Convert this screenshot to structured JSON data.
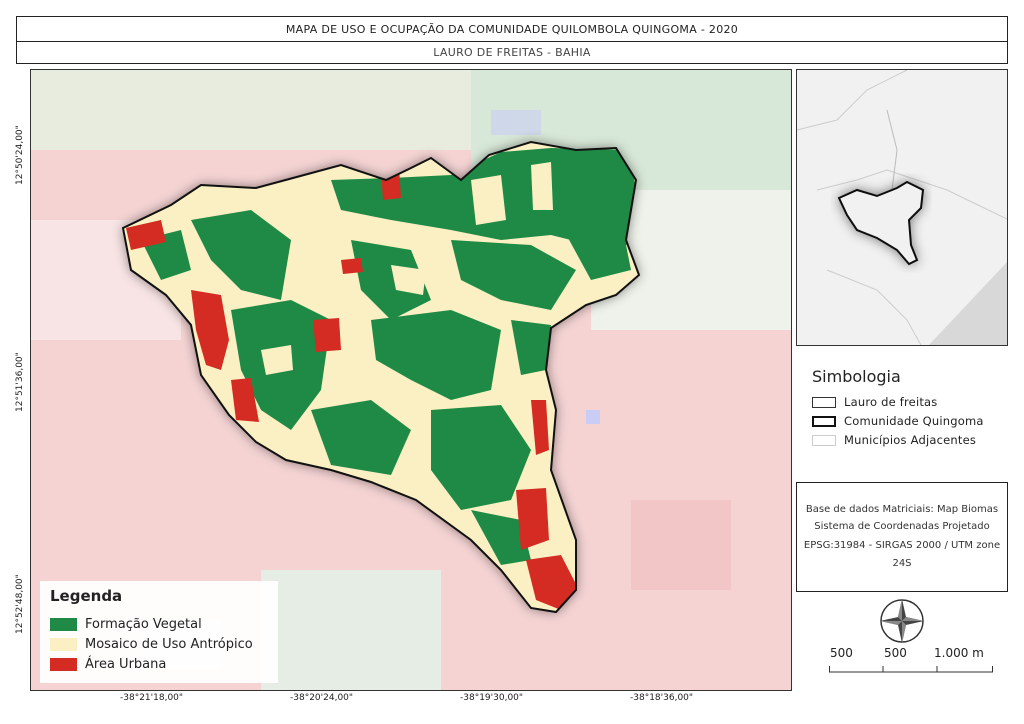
{
  "title": "MAPA DE USO E OCUPAÇÃO DA COMUNIDADE QUILOMBOLA QUINGOMA - 2020",
  "subtitle": "LAURO DE FREITAS - BAHIA",
  "coordinates": {
    "lat": [
      "12°50'24,00\"",
      "12°51'36,00\"",
      "12°52'48,00\""
    ],
    "lon": [
      "-38°21'18,00\"",
      "-38°20'24,00\"",
      "-38°19'30,00\"",
      "-38°18'36,00\""
    ]
  },
  "legend": {
    "title": "Legenda",
    "items": [
      {
        "label": "Formação Vegetal",
        "color": "#1f8a45"
      },
      {
        "label": "Mosaico de Uso Antrópico",
        "color": "#fbf0c4"
      },
      {
        "label": "Área Urbana",
        "color": "#d42b22"
      }
    ]
  },
  "symbology": {
    "title": "Simbologia",
    "items": [
      {
        "label": "Lauro de freitas",
        "stroke": "#333333",
        "width": 1
      },
      {
        "label": "Comunidade  Quingoma",
        "stroke": "#111111",
        "width": 2
      },
      {
        "label": "Municípios Adjacentes",
        "stroke": "#cccccc",
        "width": 1
      }
    ]
  },
  "data_source": [
    "Base de dados Matriciais: Map Biomas",
    "Sistema de Coordenadas Projetado",
    "EPSG:31984 - SIRGAS 2000 / UTM zone",
    "24S"
  ],
  "scale": {
    "labels": [
      "500",
      "500",
      "1.000 m"
    ]
  },
  "colors": {
    "vegetation": "#1f8a45",
    "mosaic": "#fbf0c4",
    "urban": "#d42b22",
    "background_pink": "#f5d3d3",
    "background_green": "#d8e8d8",
    "water": "#c9cdf5"
  }
}
